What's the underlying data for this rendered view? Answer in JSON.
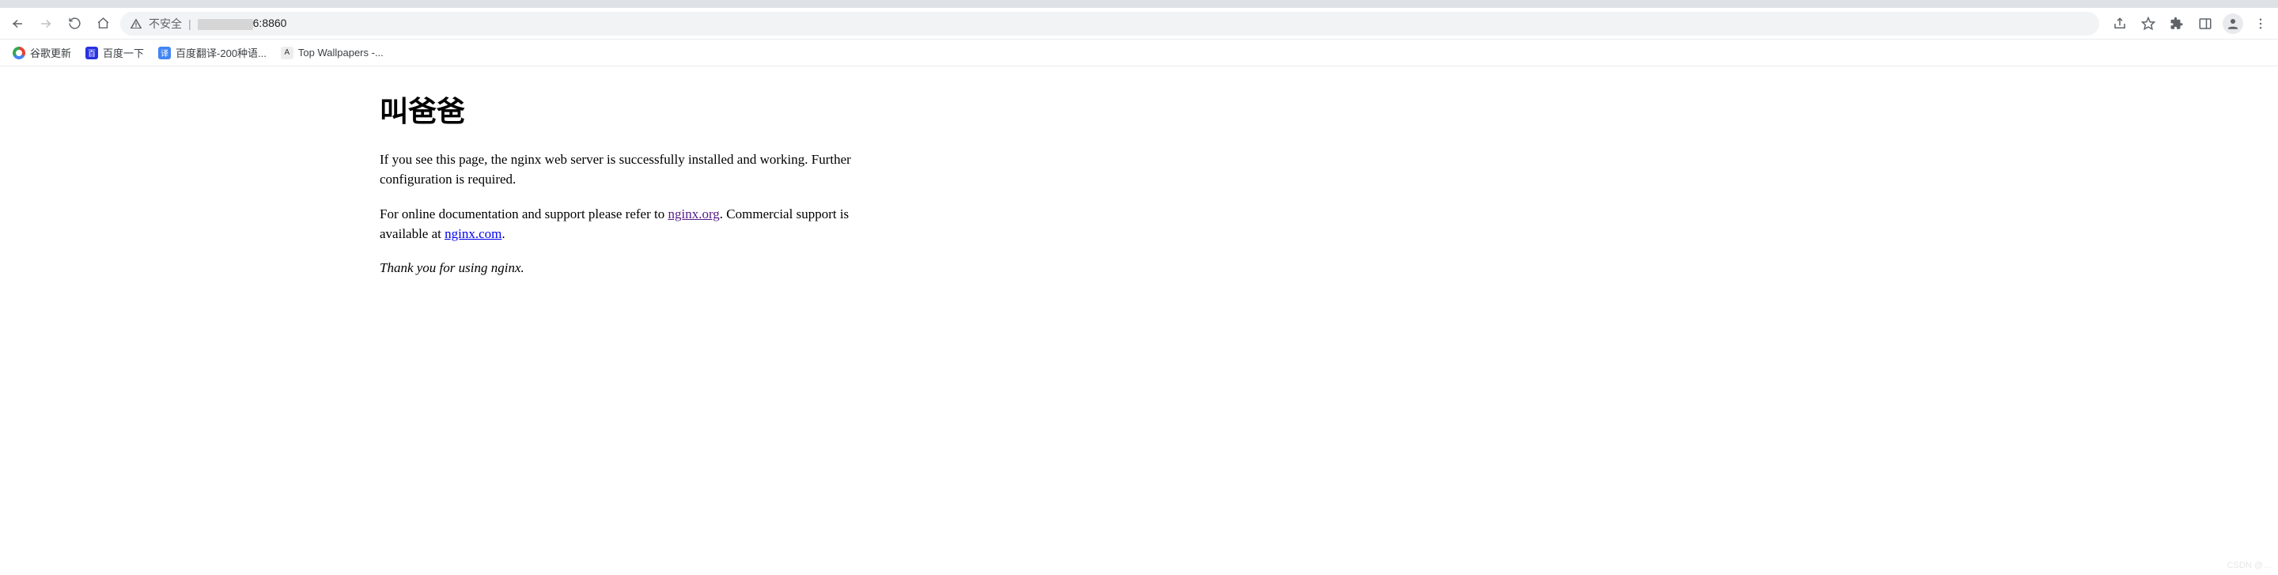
{
  "address_bar": {
    "security_label": "不安全",
    "url_visible_suffix": "6:8860"
  },
  "toolbar_right": {
    "share": "share",
    "bookmark": "star",
    "extensions": "puzzle",
    "sidepanel": "panel",
    "profile": "profile",
    "menu": "menu"
  },
  "bookmarks": [
    {
      "label": "谷歌更新",
      "icon": "chrome"
    },
    {
      "label": "百度一下",
      "icon": "baidu"
    },
    {
      "label": "百度翻译-200种语...",
      "icon": "fanyi"
    },
    {
      "label": "Top Wallpapers -...",
      "icon": "wall"
    }
  ],
  "page": {
    "heading": "叫爸爸",
    "p1": "If you see this page, the nginx web server is successfully installed and working. Further configuration is required.",
    "p2_pre": "For online documentation and support please refer to ",
    "p2_link1": "nginx.org",
    "p2_mid": ". Commercial support is available at ",
    "p2_link2": "nginx.com",
    "p2_post": ".",
    "thankyou": "Thank you for using nginx."
  },
  "watermark": "CSDN @…"
}
